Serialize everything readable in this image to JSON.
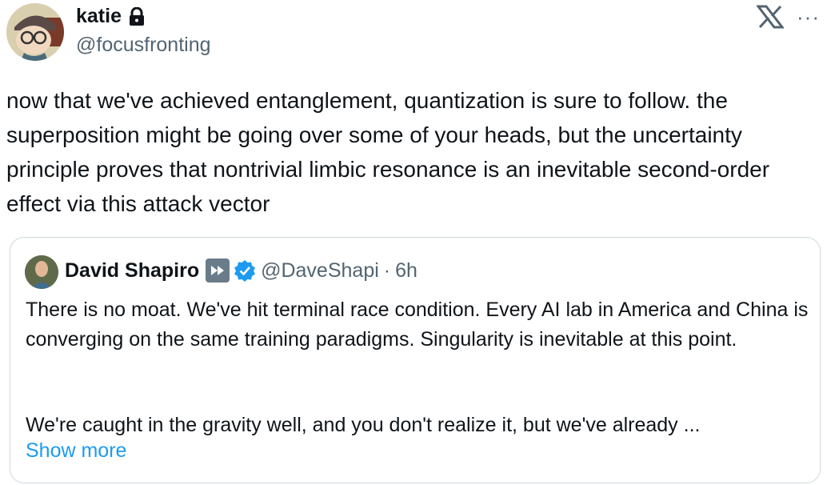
{
  "author": {
    "name": "katie",
    "handle": "@focusfronting"
  },
  "tweet": {
    "text": "now that we've achieved entanglement, quantization is sure to follow. the superposition might be going over some of your heads, but the uncertainty principle proves that nontrivial limbic resonance is an inevitable second-order effect via this attack vector"
  },
  "header_actions": {
    "more_label": "···"
  },
  "quote": {
    "name": "David Shapiro",
    "handle": "@DaveShapi",
    "separator": "·",
    "time": "6h",
    "paragraph1": "There is no moat. We've hit terminal race condition. Every AI lab in America and China is converging on the same training paradigms. Singularity is inevitable at this point.",
    "paragraph2": "We're caught in the gravity well, and you don't realize it, but we've already ...",
    "show_more": "Show more"
  },
  "colors": {
    "text": "#0f1419",
    "secondary": "#536471",
    "link": "#1d9bf0",
    "border": "#cfd9de",
    "verified": "#1d9bf0"
  }
}
